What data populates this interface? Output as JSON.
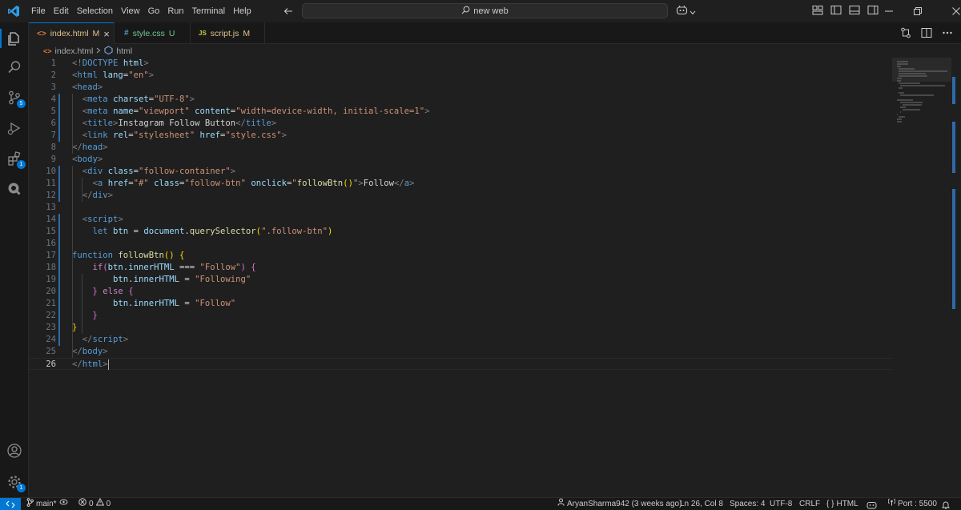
{
  "menu": [
    "File",
    "Edit",
    "Selection",
    "View",
    "Go",
    "Run",
    "Terminal",
    "Help"
  ],
  "command_center": {
    "text": "new web"
  },
  "tabs": [
    {
      "label": "index.html",
      "status": "M",
      "icon": "<>",
      "icon_color": "#e37933",
      "status_color": "#e2c08d",
      "close": "×"
    },
    {
      "label": "style.css",
      "status": "U",
      "icon": "#",
      "icon_color": "#519aba",
      "status_color": "#73c991"
    },
    {
      "label": "script.js",
      "status": "M",
      "icon": "JS",
      "icon_color": "#cbcb41",
      "status_color": "#e2c08d"
    }
  ],
  "breadcrumb": {
    "file": "index.html",
    "symbol": "html"
  },
  "activity_badges": {
    "source_control": "5",
    "extensions": "1",
    "manage": "1"
  },
  "editor": {
    "current_line": 26,
    "lines": [
      [
        [
          "t-tag",
          "<!"
        ],
        [
          "t-dt",
          "DOCTYPE"
        ],
        [
          "t-txt",
          " "
        ],
        [
          "t-attr",
          "html"
        ],
        [
          "t-tag",
          ">"
        ]
      ],
      [
        [
          "t-tag",
          "<"
        ],
        [
          "t-name",
          "html"
        ],
        [
          "t-txt",
          " "
        ],
        [
          "t-attr",
          "lang"
        ],
        [
          "t-txt",
          "="
        ],
        [
          "t-str",
          "\"en\""
        ],
        [
          "t-tag",
          ">"
        ]
      ],
      [
        [
          "t-tag",
          "<"
        ],
        [
          "t-name",
          "head"
        ],
        [
          "t-tag",
          ">"
        ]
      ],
      [
        [
          "t-txt",
          "  "
        ],
        [
          "t-tag",
          "<"
        ],
        [
          "t-name",
          "meta"
        ],
        [
          "t-txt",
          " "
        ],
        [
          "t-attr",
          "charset"
        ],
        [
          "t-txt",
          "="
        ],
        [
          "t-str",
          "\"UTF-8\""
        ],
        [
          "t-tag",
          ">"
        ]
      ],
      [
        [
          "t-txt",
          "  "
        ],
        [
          "t-tag",
          "<"
        ],
        [
          "t-name",
          "meta"
        ],
        [
          "t-txt",
          " "
        ],
        [
          "t-attr",
          "name"
        ],
        [
          "t-txt",
          "="
        ],
        [
          "t-str",
          "\"viewport\""
        ],
        [
          "t-txt",
          " "
        ],
        [
          "t-attr",
          "content"
        ],
        [
          "t-txt",
          "="
        ],
        [
          "t-str",
          "\"width=device-width, initial-scale=1\""
        ],
        [
          "t-tag",
          ">"
        ]
      ],
      [
        [
          "t-txt",
          "  "
        ],
        [
          "t-tag",
          "<"
        ],
        [
          "t-name",
          "title"
        ],
        [
          "t-tag",
          ">"
        ],
        [
          "t-txt",
          "Instagram Follow Button"
        ],
        [
          "t-tag",
          "</"
        ],
        [
          "t-name",
          "title"
        ],
        [
          "t-tag",
          ">"
        ]
      ],
      [
        [
          "t-txt",
          "  "
        ],
        [
          "t-tag",
          "<"
        ],
        [
          "t-name",
          "link"
        ],
        [
          "t-txt",
          " "
        ],
        [
          "t-attr",
          "rel"
        ],
        [
          "t-txt",
          "="
        ],
        [
          "t-str",
          "\"stylesheet\""
        ],
        [
          "t-txt",
          " "
        ],
        [
          "t-attr",
          "href"
        ],
        [
          "t-txt",
          "="
        ],
        [
          "t-str",
          "\"style.css\""
        ],
        [
          "t-tag",
          ">"
        ]
      ],
      [
        [
          "t-tag",
          "</"
        ],
        [
          "t-name",
          "head"
        ],
        [
          "t-tag",
          ">"
        ]
      ],
      [
        [
          "t-tag",
          "<"
        ],
        [
          "t-name",
          "body"
        ],
        [
          "t-tag",
          ">"
        ]
      ],
      [
        [
          "t-txt",
          "  "
        ],
        [
          "t-tag",
          "<"
        ],
        [
          "t-name",
          "div"
        ],
        [
          "t-txt",
          " "
        ],
        [
          "t-attr",
          "class"
        ],
        [
          "t-txt",
          "="
        ],
        [
          "t-str",
          "\"follow-container\""
        ],
        [
          "t-tag",
          ">"
        ]
      ],
      [
        [
          "t-txt",
          "    "
        ],
        [
          "t-tag",
          "<"
        ],
        [
          "t-name",
          "a"
        ],
        [
          "t-txt",
          " "
        ],
        [
          "t-attr",
          "href"
        ],
        [
          "t-txt",
          "="
        ],
        [
          "t-str",
          "\"#\""
        ],
        [
          "t-txt",
          " "
        ],
        [
          "t-attr",
          "class"
        ],
        [
          "t-txt",
          "="
        ],
        [
          "t-str",
          "\"follow-btn\""
        ],
        [
          "t-txt",
          " "
        ],
        [
          "t-attr",
          "onclick"
        ],
        [
          "t-txt",
          "="
        ],
        [
          "t-str",
          "\""
        ],
        [
          "t-fn",
          "followBtn"
        ],
        [
          "t-br1",
          "()"
        ],
        [
          "t-str",
          "\""
        ],
        [
          "t-tag",
          ">"
        ],
        [
          "t-txt",
          "Follow"
        ],
        [
          "t-tag",
          "</"
        ],
        [
          "t-name",
          "a"
        ],
        [
          "t-tag",
          ">"
        ]
      ],
      [
        [
          "t-txt",
          "  "
        ],
        [
          "t-tag",
          "</"
        ],
        [
          "t-name",
          "div"
        ],
        [
          "t-tag",
          ">"
        ]
      ],
      [],
      [
        [
          "t-txt",
          "  "
        ],
        [
          "t-tag",
          "<"
        ],
        [
          "t-name",
          "script"
        ],
        [
          "t-tag",
          ">"
        ]
      ],
      [
        [
          "t-txt",
          "    "
        ],
        [
          "t-kw",
          "let"
        ],
        [
          "t-txt",
          " "
        ],
        [
          "t-var",
          "btn"
        ],
        [
          "t-txt",
          " = "
        ],
        [
          "t-var",
          "document"
        ],
        [
          "t-txt",
          "."
        ],
        [
          "t-fn",
          "querySelector"
        ],
        [
          "t-br1",
          "("
        ],
        [
          "t-str",
          "\".follow-btn\""
        ],
        [
          "t-br1",
          ")"
        ]
      ],
      [],
      [
        [
          "t-kw",
          "function"
        ],
        [
          "t-txt",
          " "
        ],
        [
          "t-fn",
          "followBtn"
        ],
        [
          "t-br1",
          "() {"
        ]
      ],
      [
        [
          "t-txt",
          "    "
        ],
        [
          "t-ctl",
          "if"
        ],
        [
          "t-br2",
          "("
        ],
        [
          "t-var",
          "btn"
        ],
        [
          "t-txt",
          "."
        ],
        [
          "t-var",
          "innerHTML"
        ],
        [
          "t-txt",
          " === "
        ],
        [
          "t-str",
          "\"Follow\""
        ],
        [
          "t-br2",
          ") {"
        ]
      ],
      [
        [
          "t-txt",
          "        "
        ],
        [
          "t-var",
          "btn"
        ],
        [
          "t-txt",
          "."
        ],
        [
          "t-var",
          "innerHTML"
        ],
        [
          "t-txt",
          " = "
        ],
        [
          "t-str",
          "\"Following\""
        ]
      ],
      [
        [
          "t-txt",
          "    "
        ],
        [
          "t-br2",
          "}"
        ],
        [
          "t-txt",
          " "
        ],
        [
          "t-ctl",
          "else"
        ],
        [
          "t-txt",
          " "
        ],
        [
          "t-br2",
          "{"
        ]
      ],
      [
        [
          "t-txt",
          "        "
        ],
        [
          "t-var",
          "btn"
        ],
        [
          "t-txt",
          "."
        ],
        [
          "t-var",
          "innerHTML"
        ],
        [
          "t-txt",
          " = "
        ],
        [
          "t-str",
          "\"Follow\""
        ]
      ],
      [
        [
          "t-txt",
          "    "
        ],
        [
          "t-br2",
          "}"
        ]
      ],
      [
        [
          "t-br1",
          "}"
        ]
      ],
      [
        [
          "t-txt",
          "  "
        ],
        [
          "t-tag",
          "</"
        ],
        [
          "t-name",
          "script"
        ],
        [
          "t-tag",
          ">"
        ]
      ],
      [
        [
          "t-tag",
          "</"
        ],
        [
          "t-name",
          "body"
        ],
        [
          "t-tag",
          ">"
        ]
      ],
      [
        [
          "t-tag",
          "</"
        ],
        [
          "t-name",
          "html"
        ],
        [
          "t-tag",
          ">"
        ]
      ]
    ]
  },
  "statusbar": {
    "branch": "main*",
    "errors": "0",
    "warnings": "0",
    "blame": "AryanSharma942 (3 weeks ago)",
    "position": "Ln 26, Col 8",
    "spaces": "Spaces: 4",
    "encoding": "UTF-8",
    "eol": "CRLF",
    "language": "HTML",
    "port": "Port : 5500"
  },
  "colors": {
    "accent": "#0078d4",
    "background": "#1f1f1f"
  }
}
